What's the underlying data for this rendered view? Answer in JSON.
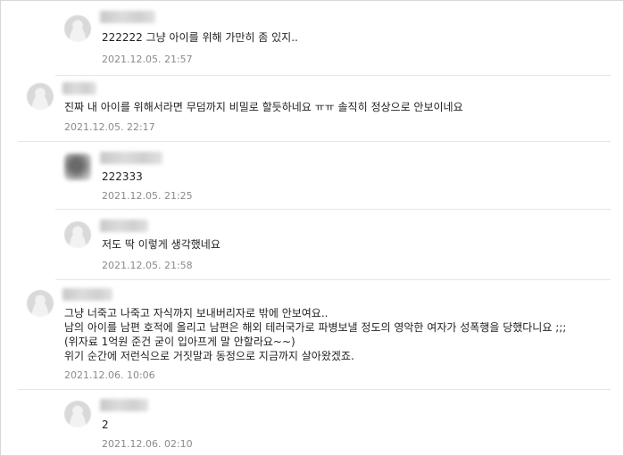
{
  "comments": [
    {
      "text": "222222 그냥 아이를 위해 가만히 좀 있지..",
      "date": "2021.12.05. 21:57",
      "reply": true
    },
    {
      "text": "진짜 내 아이를 위해서라면 무덤까지 비밀로 할듯하네요 ㅠㅠ 솔직히 정상으로 안보이네요",
      "date": "2021.12.05. 22:17",
      "reply": false
    },
    {
      "text": "222333",
      "date": "2021.12.05. 21:25",
      "reply": true
    },
    {
      "text": "저도 딱 이렇게 생각했네요",
      "date": "2021.12.05. 21:58",
      "reply": true
    },
    {
      "lines": [
        "그냥 너죽고 나죽고 자식까지 보내버리자로 밖에 안보여요..",
        "남의 아이를 남편 호적에 올리고 남편은 해외 테러국가로 파병보낼 정도의 영악한 여자가 성폭행을 당했다니요 ;;;",
        "(위자료 1억원 준건 굳이 입아프게 말 안할라요~~)",
        "위기 순간에 저런식으로 거짓말과 동정으로 지금까지 살아왔겠죠."
      ],
      "date": "2021.12.06. 10:06",
      "reply": false
    },
    {
      "text": "2",
      "date": "2021.12.06. 02:10",
      "reply": true
    }
  ]
}
